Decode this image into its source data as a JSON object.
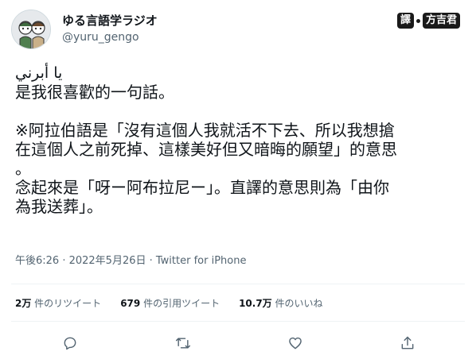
{
  "user": {
    "display_name": "ゆる言語学ラジオ",
    "handle": "@yuru_gengo"
  },
  "translator_badge": {
    "mark": "譯",
    "name": "方吉君"
  },
  "tweet": {
    "lines": [
      "يا أبرني",
      "是我很喜歡的一句話。",
      "",
      "※阿拉伯語是「沒有這個人我就活不下去、所以我想搶",
      "在這個人之前死掉、這樣美好但又暗晦的願望」的意思",
      "。",
      "念起來是「呀ー阿布拉尼ー」。直譯的意思則為「由你",
      "為我送葬」。"
    ]
  },
  "meta": {
    "timestamp": "午後6:26 · 2022年5月26日 · Twitter for iPhone"
  },
  "stats": {
    "retweets_value": "2万",
    "retweets_label": " 件のリツイート",
    "quotes_value": "679",
    "quotes_label": " 件の引用ツイート",
    "likes_value": "10.7万",
    "likes_label": " 件のいいね"
  },
  "actions": [
    "reply-icon",
    "retweet-icon",
    "like-icon",
    "share-icon"
  ]
}
